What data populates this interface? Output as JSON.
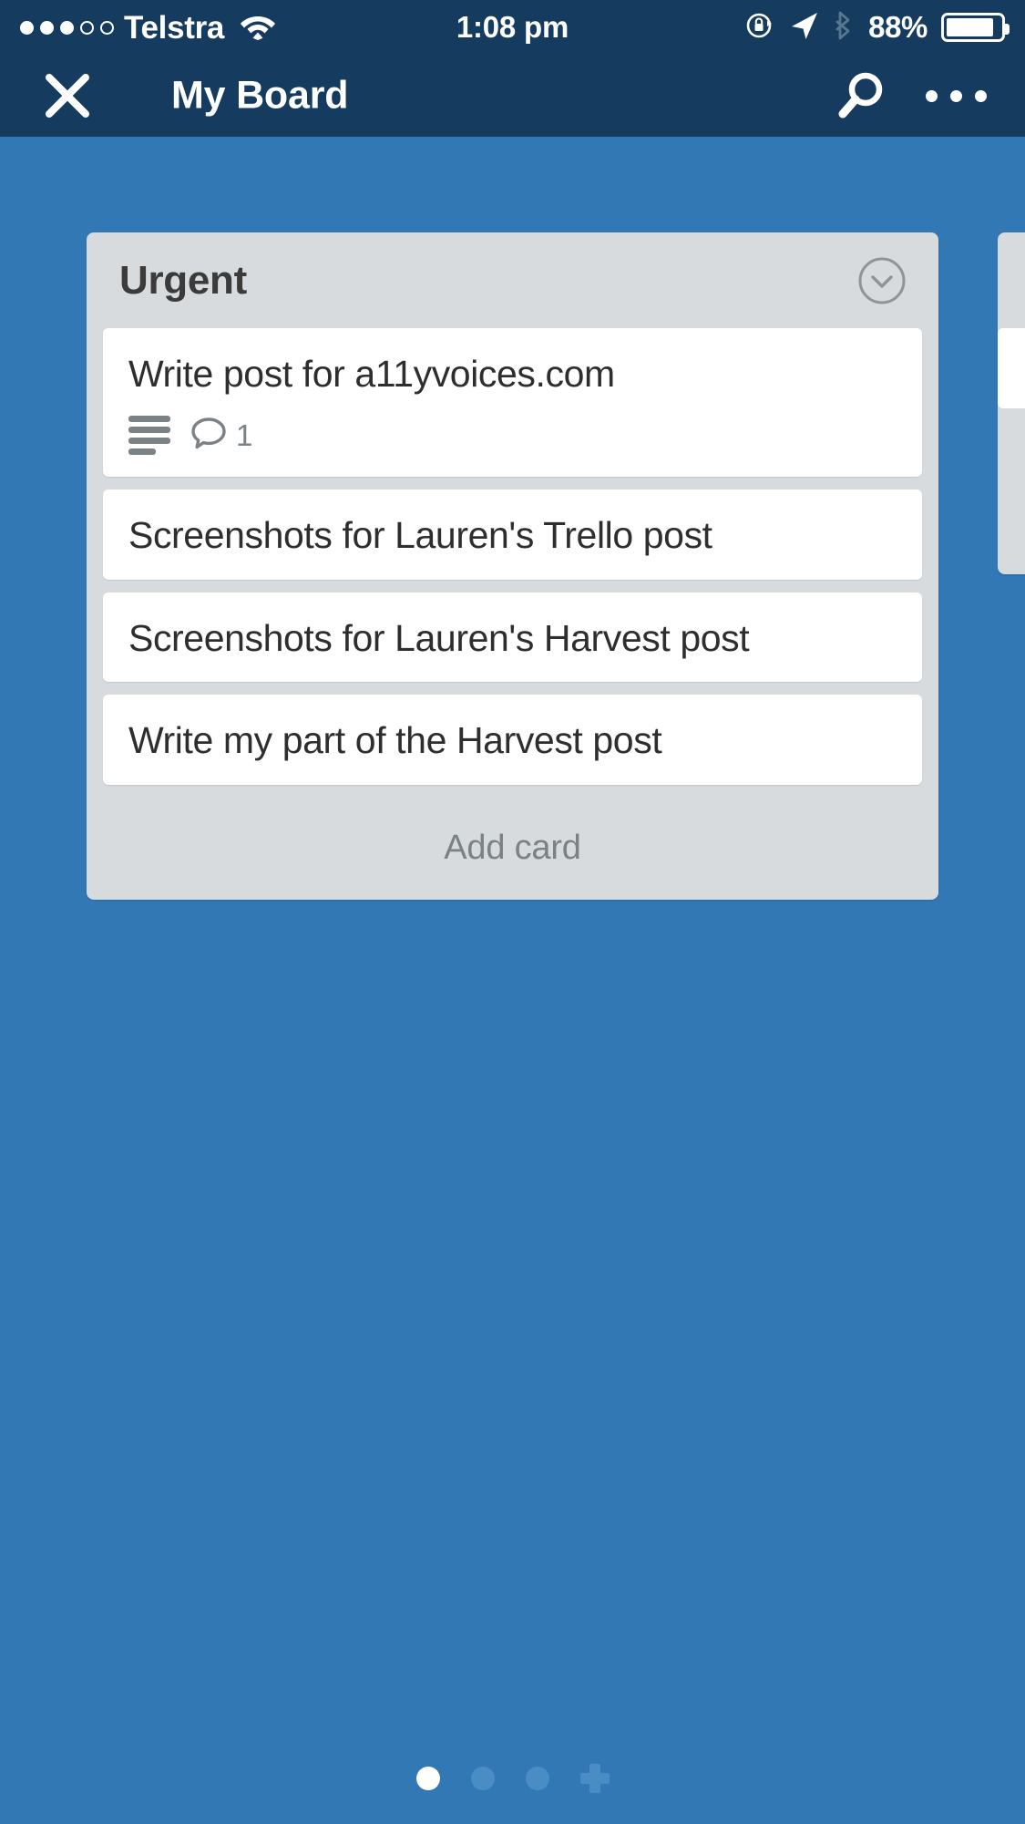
{
  "status_bar": {
    "carrier": "Telstra",
    "signal_bars_filled": 3,
    "signal_bars_total": 5,
    "wifi_icon": "wifi-icon",
    "time": "1:08 pm",
    "rotation_lock_icon": "rotation-lock-icon",
    "location_icon": "location-arrow-icon",
    "bluetooth_icon": "bluetooth-icon",
    "battery_percent": "88%",
    "battery_level": 88
  },
  "nav_bar": {
    "close_icon": "close-icon",
    "title": "My Board",
    "search_icon": "search-icon",
    "more_icon": "overflow-menu-icon"
  },
  "board": {
    "background_color": "#3178b5",
    "lists": [
      {
        "name": "Urgent",
        "collapse_icon": "chevron-down-circle-icon",
        "add_card_label": "Add card",
        "cards": [
          {
            "title": "Write post for a11yvoices.com",
            "badges": [
              {
                "type": "description",
                "icon": "description-icon",
                "count": ""
              },
              {
                "type": "comments",
                "icon": "comment-bubble-icon",
                "count": "1"
              }
            ]
          },
          {
            "title": "Screenshots for Lauren's Trello post",
            "badges": []
          },
          {
            "title": "Screenshots for Lauren's Harvest post",
            "badges": []
          },
          {
            "title": "Write my part of the Harvest post",
            "badges": []
          }
        ]
      }
    ]
  },
  "pager": {
    "dots": [
      "active",
      "idle",
      "idle"
    ],
    "add_list_icon": "plus-icon"
  },
  "colors": {
    "chrome": "#153c5e",
    "board_bg": "#3178b5",
    "list_bg": "#d7dbdd",
    "card_bg": "#ffffff",
    "card_text": "#2e2e2e",
    "muted_text": "#7b8285"
  }
}
